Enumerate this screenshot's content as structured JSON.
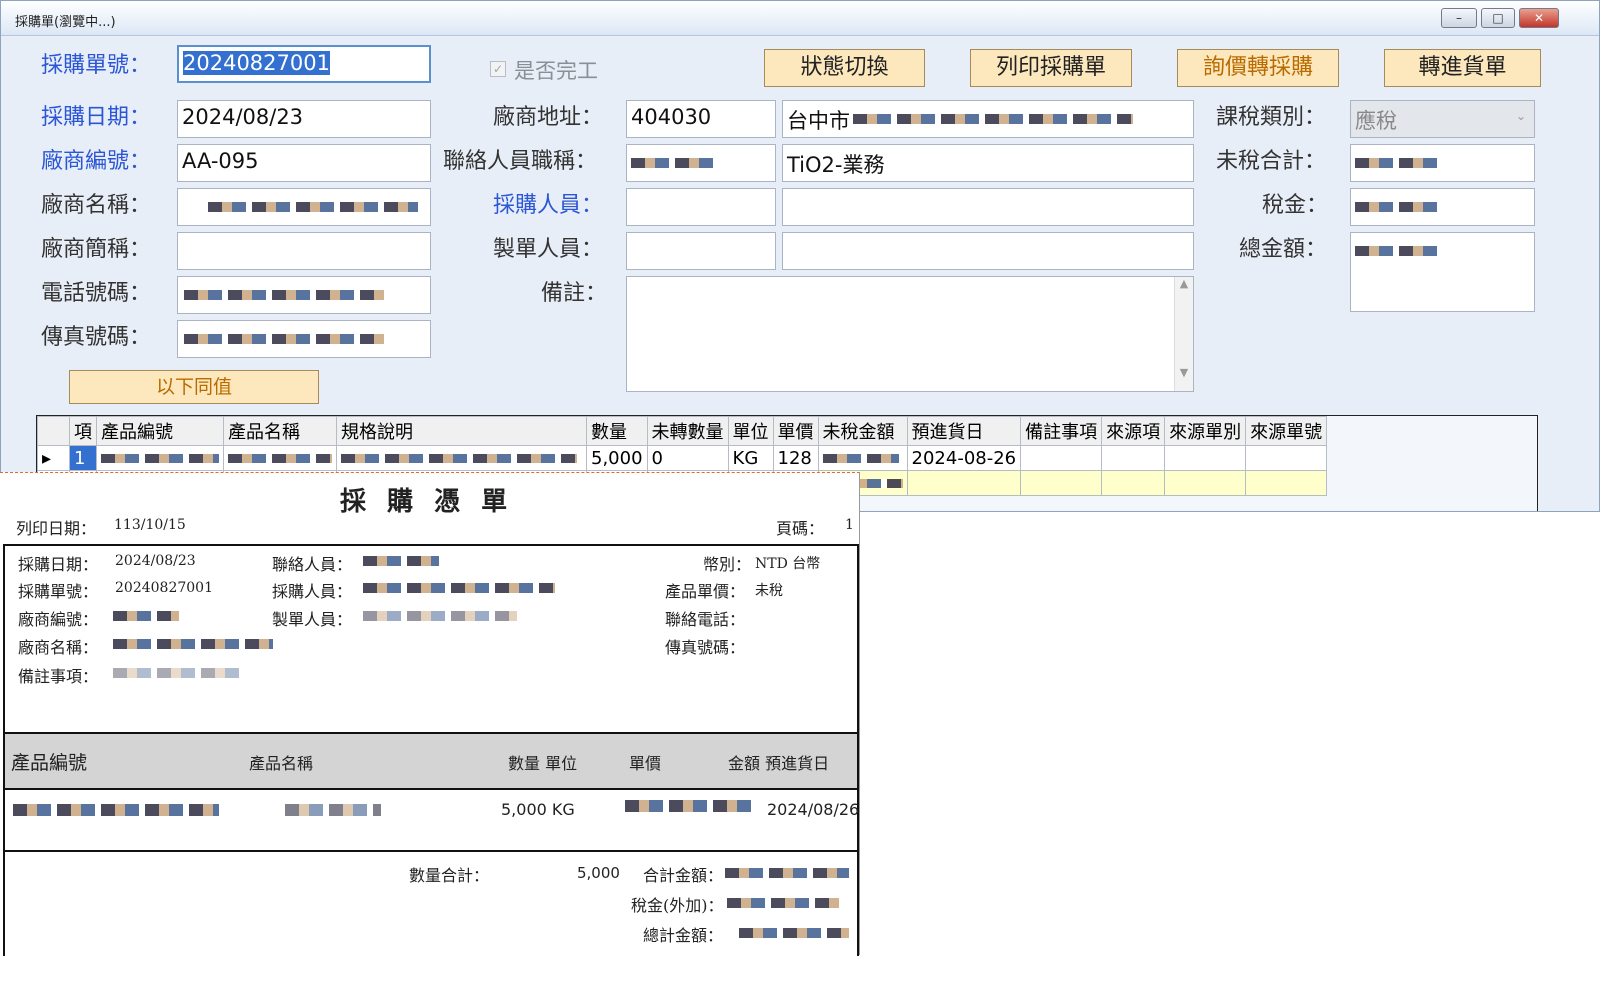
{
  "window": {
    "title": "採購單(瀏覽中...)",
    "min": "–",
    "max": "□",
    "close": "✕"
  },
  "form": {
    "po_no_label": "採購單號：",
    "po_no": "20240827001",
    "po_date_label": "採購日期：",
    "po_date": "2024/08/23",
    "vendor_code_label": "廠商編號：",
    "vendor_code": "AA-095",
    "vendor_name_label": "廠商名稱：",
    "vendor_short_label": "廠商簡稱：",
    "phone_label": "電話號碼：",
    "fax_label": "傳真號碼：",
    "same_below": "以下同值",
    "completed_label": "是否完工",
    "addr_label": "廠商地址：",
    "zip": "404030",
    "city": "台中市",
    "contact_title_label": "聯絡人員職稱：",
    "contact_title": "TiO2-業務",
    "buyer_label": "採購人員：",
    "maker_label": "製單人員：",
    "remark_label": "備註：",
    "tax_type_label": "課稅類別：",
    "tax_type": "應稅",
    "untaxed_label": "未稅合計：",
    "tax_label": "稅金：",
    "total_label": "總金額："
  },
  "buttons": {
    "toggle": "狀態切換",
    "print": "列印採購單",
    "convert": "詢價轉採購",
    "receive": "轉進貨單"
  },
  "grid": {
    "headers": [
      "項",
      "產品編號",
      "產品名稱",
      "規格說明",
      "數量",
      "未轉數量",
      "單位",
      "單價",
      "未稅金額",
      "預進貨日",
      "備註事項",
      "來源項",
      "來源單別",
      "來源單號"
    ],
    "row": {
      "item": "1",
      "qty": "5,000",
      "unconverted": "0",
      "unit": "KG",
      "price": "128",
      "date": "2024-08-26"
    }
  },
  "report": {
    "title": "採 購 憑 單",
    "print_date_label": "列印日期：",
    "print_date": "113/10/15",
    "page_label": "頁碼：",
    "page": "1",
    "po_date_label": "採購日期：",
    "po_date": "2024/08/23",
    "po_no_label": "採購單號：",
    "po_no": "20240827001",
    "vendor_code_label": "廠商編號：",
    "vendor_name_label": "廠商名稱：",
    "remark_label": "備註事項：",
    "contact_label": "聯絡人員：",
    "buyer_label": "採購人員：",
    "maker_label": "製單人員：",
    "currency_label": "幣別：",
    "currency": "NTD 台幣",
    "unit_price_label": "產品單價：",
    "unit_price": "未稅",
    "phone_label": "聯絡電話：",
    "fax_label": "傳真號碼：",
    "col_code": "產品編號",
    "col_name": "產品名稱",
    "col_qty_unit": "數量 單位",
    "col_price": "單價",
    "col_amount_date": "金額 預進貨日",
    "line_qty": "5,000 KG",
    "line_date": "2024/08/26",
    "qty_total_label": "數量合計：",
    "qty_total": "5,000",
    "sum_label": "合計金額：",
    "tax_label": "稅金(外加)：",
    "grand_label": "總計金額："
  }
}
